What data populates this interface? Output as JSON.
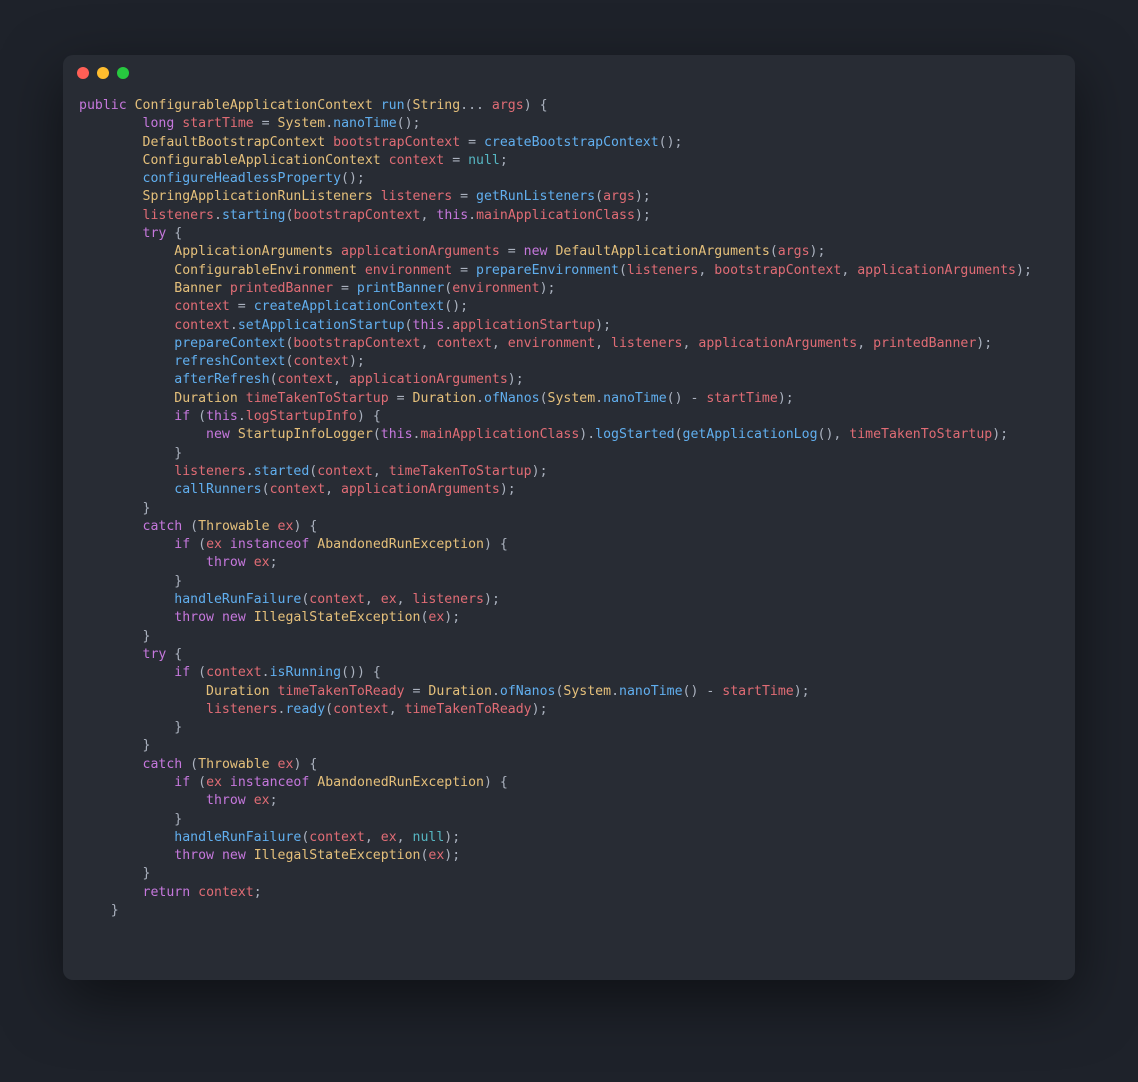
{
  "window": {
    "traffic_lights": [
      "close",
      "minimize",
      "maximize"
    ]
  },
  "code": {
    "tokens": [
      [
        [
          "k",
          "public"
        ],
        [
          "s",
          " "
        ],
        [
          "t",
          "ConfigurableApplicationContext"
        ],
        [
          "s",
          " "
        ],
        [
          "m",
          "run"
        ],
        [
          "s",
          "("
        ],
        [
          "t",
          "String"
        ],
        [
          "s",
          "... "
        ],
        [
          "v",
          "args"
        ],
        [
          "s",
          ") {"
        ]
      ],
      [
        [
          "s",
          "        "
        ],
        [
          "k",
          "long"
        ],
        [
          "s",
          " "
        ],
        [
          "v",
          "startTime"
        ],
        [
          "s",
          " = "
        ],
        [
          "t",
          "System"
        ],
        [
          "s",
          "."
        ],
        [
          "m",
          "nanoTime"
        ],
        [
          "s",
          "();"
        ]
      ],
      [
        [
          "s",
          "        "
        ],
        [
          "t",
          "DefaultBootstrapContext"
        ],
        [
          "s",
          " "
        ],
        [
          "v",
          "bootstrapContext"
        ],
        [
          "s",
          " = "
        ],
        [
          "m",
          "createBootstrapContext"
        ],
        [
          "s",
          "();"
        ]
      ],
      [
        [
          "s",
          "        "
        ],
        [
          "t",
          "ConfigurableApplicationContext"
        ],
        [
          "s",
          " "
        ],
        [
          "v",
          "context"
        ],
        [
          "s",
          " = "
        ],
        [
          "n",
          "null"
        ],
        [
          "s",
          ";"
        ]
      ],
      [
        [
          "s",
          "        "
        ],
        [
          "m",
          "configureHeadlessProperty"
        ],
        [
          "s",
          "();"
        ]
      ],
      [
        [
          "s",
          "        "
        ],
        [
          "t",
          "SpringApplicationRunListeners"
        ],
        [
          "s",
          " "
        ],
        [
          "v",
          "listeners"
        ],
        [
          "s",
          " = "
        ],
        [
          "m",
          "getRunListeners"
        ],
        [
          "s",
          "("
        ],
        [
          "v",
          "args"
        ],
        [
          "s",
          ");"
        ]
      ],
      [
        [
          "s",
          "        "
        ],
        [
          "v",
          "listeners"
        ],
        [
          "s",
          "."
        ],
        [
          "m",
          "starting"
        ],
        [
          "s",
          "("
        ],
        [
          "v",
          "bootstrapContext"
        ],
        [
          "s",
          ", "
        ],
        [
          "k",
          "this"
        ],
        [
          "s",
          "."
        ],
        [
          "v",
          "mainApplicationClass"
        ],
        [
          "s",
          ");"
        ]
      ],
      [
        [
          "s",
          "        "
        ],
        [
          "k",
          "try"
        ],
        [
          "s",
          " {"
        ]
      ],
      [
        [
          "s",
          "            "
        ],
        [
          "t",
          "ApplicationArguments"
        ],
        [
          "s",
          " "
        ],
        [
          "v",
          "applicationArguments"
        ],
        [
          "s",
          " = "
        ],
        [
          "k",
          "new"
        ],
        [
          "s",
          " "
        ],
        [
          "t",
          "DefaultApplicationArguments"
        ],
        [
          "s",
          "("
        ],
        [
          "v",
          "args"
        ],
        [
          "s",
          ");"
        ]
      ],
      [
        [
          "s",
          "            "
        ],
        [
          "t",
          "ConfigurableEnvironment"
        ],
        [
          "s",
          " "
        ],
        [
          "v",
          "environment"
        ],
        [
          "s",
          " = "
        ],
        [
          "m",
          "prepareEnvironment"
        ],
        [
          "s",
          "("
        ],
        [
          "v",
          "listeners"
        ],
        [
          "s",
          ", "
        ],
        [
          "v",
          "bootstrapContext"
        ],
        [
          "s",
          ", "
        ],
        [
          "v",
          "applicationArguments"
        ],
        [
          "s",
          ");"
        ]
      ],
      [
        [
          "s",
          "            "
        ],
        [
          "t",
          "Banner"
        ],
        [
          "s",
          " "
        ],
        [
          "v",
          "printedBanner"
        ],
        [
          "s",
          " = "
        ],
        [
          "m",
          "printBanner"
        ],
        [
          "s",
          "("
        ],
        [
          "v",
          "environment"
        ],
        [
          "s",
          ");"
        ]
      ],
      [
        [
          "s",
          "            "
        ],
        [
          "v",
          "context"
        ],
        [
          "s",
          " = "
        ],
        [
          "m",
          "createApplicationContext"
        ],
        [
          "s",
          "();"
        ]
      ],
      [
        [
          "s",
          "            "
        ],
        [
          "v",
          "context"
        ],
        [
          "s",
          "."
        ],
        [
          "m",
          "setApplicationStartup"
        ],
        [
          "s",
          "("
        ],
        [
          "k",
          "this"
        ],
        [
          "s",
          "."
        ],
        [
          "v",
          "applicationStartup"
        ],
        [
          "s",
          ");"
        ]
      ],
      [
        [
          "s",
          "            "
        ],
        [
          "m",
          "prepareContext"
        ],
        [
          "s",
          "("
        ],
        [
          "v",
          "bootstrapContext"
        ],
        [
          "s",
          ", "
        ],
        [
          "v",
          "context"
        ],
        [
          "s",
          ", "
        ],
        [
          "v",
          "environment"
        ],
        [
          "s",
          ", "
        ],
        [
          "v",
          "listeners"
        ],
        [
          "s",
          ", "
        ],
        [
          "v",
          "applicationArguments"
        ],
        [
          "s",
          ", "
        ],
        [
          "v",
          "printedBanner"
        ],
        [
          "s",
          ");"
        ]
      ],
      [
        [
          "s",
          "            "
        ],
        [
          "m",
          "refreshContext"
        ],
        [
          "s",
          "("
        ],
        [
          "v",
          "context"
        ],
        [
          "s",
          ");"
        ]
      ],
      [
        [
          "s",
          "            "
        ],
        [
          "m",
          "afterRefresh"
        ],
        [
          "s",
          "("
        ],
        [
          "v",
          "context"
        ],
        [
          "s",
          ", "
        ],
        [
          "v",
          "applicationArguments"
        ],
        [
          "s",
          ");"
        ]
      ],
      [
        [
          "s",
          "            "
        ],
        [
          "t",
          "Duration"
        ],
        [
          "s",
          " "
        ],
        [
          "v",
          "timeTakenToStartup"
        ],
        [
          "s",
          " = "
        ],
        [
          "t",
          "Duration"
        ],
        [
          "s",
          "."
        ],
        [
          "m",
          "ofNanos"
        ],
        [
          "s",
          "("
        ],
        [
          "t",
          "System"
        ],
        [
          "s",
          "."
        ],
        [
          "m",
          "nanoTime"
        ],
        [
          "s",
          "() - "
        ],
        [
          "v",
          "startTime"
        ],
        [
          "s",
          ");"
        ]
      ],
      [
        [
          "s",
          "            "
        ],
        [
          "k",
          "if"
        ],
        [
          "s",
          " ("
        ],
        [
          "k",
          "this"
        ],
        [
          "s",
          "."
        ],
        [
          "v",
          "logStartupInfo"
        ],
        [
          "s",
          ") {"
        ]
      ],
      [
        [
          "s",
          "                "
        ],
        [
          "k",
          "new"
        ],
        [
          "s",
          " "
        ],
        [
          "t",
          "StartupInfoLogger"
        ],
        [
          "s",
          "("
        ],
        [
          "k",
          "this"
        ],
        [
          "s",
          "."
        ],
        [
          "v",
          "mainApplicationClass"
        ],
        [
          "s",
          ")."
        ],
        [
          "m",
          "logStarted"
        ],
        [
          "s",
          "("
        ],
        [
          "m",
          "getApplicationLog"
        ],
        [
          "s",
          "(), "
        ],
        [
          "v",
          "timeTakenToStartup"
        ],
        [
          "s",
          ");"
        ]
      ],
      [
        [
          "s",
          "            }"
        ]
      ],
      [
        [
          "s",
          "            "
        ],
        [
          "v",
          "listeners"
        ],
        [
          "s",
          "."
        ],
        [
          "m",
          "started"
        ],
        [
          "s",
          "("
        ],
        [
          "v",
          "context"
        ],
        [
          "s",
          ", "
        ],
        [
          "v",
          "timeTakenToStartup"
        ],
        [
          "s",
          ");"
        ]
      ],
      [
        [
          "s",
          "            "
        ],
        [
          "m",
          "callRunners"
        ],
        [
          "s",
          "("
        ],
        [
          "v",
          "context"
        ],
        [
          "s",
          ", "
        ],
        [
          "v",
          "applicationArguments"
        ],
        [
          "s",
          ");"
        ]
      ],
      [
        [
          "s",
          "        }"
        ]
      ],
      [
        [
          "s",
          "        "
        ],
        [
          "k",
          "catch"
        ],
        [
          "s",
          " ("
        ],
        [
          "t",
          "Throwable"
        ],
        [
          "s",
          " "
        ],
        [
          "v",
          "ex"
        ],
        [
          "s",
          ") {"
        ]
      ],
      [
        [
          "s",
          "            "
        ],
        [
          "k",
          "if"
        ],
        [
          "s",
          " ("
        ],
        [
          "v",
          "ex"
        ],
        [
          "s",
          " "
        ],
        [
          "k",
          "instanceof"
        ],
        [
          "s",
          " "
        ],
        [
          "t",
          "AbandonedRunException"
        ],
        [
          "s",
          ") {"
        ]
      ],
      [
        [
          "s",
          "                "
        ],
        [
          "k",
          "throw"
        ],
        [
          "s",
          " "
        ],
        [
          "v",
          "ex"
        ],
        [
          "s",
          ";"
        ]
      ],
      [
        [
          "s",
          "            }"
        ]
      ],
      [
        [
          "s",
          "            "
        ],
        [
          "m",
          "handleRunFailure"
        ],
        [
          "s",
          "("
        ],
        [
          "v",
          "context"
        ],
        [
          "s",
          ", "
        ],
        [
          "v",
          "ex"
        ],
        [
          "s",
          ", "
        ],
        [
          "v",
          "listeners"
        ],
        [
          "s",
          ");"
        ]
      ],
      [
        [
          "s",
          "            "
        ],
        [
          "k",
          "throw"
        ],
        [
          "s",
          " "
        ],
        [
          "k",
          "new"
        ],
        [
          "s",
          " "
        ],
        [
          "t",
          "IllegalStateException"
        ],
        [
          "s",
          "("
        ],
        [
          "v",
          "ex"
        ],
        [
          "s",
          ");"
        ]
      ],
      [
        [
          "s",
          "        }"
        ]
      ],
      [
        [
          "s",
          "        "
        ],
        [
          "k",
          "try"
        ],
        [
          "s",
          " {"
        ]
      ],
      [
        [
          "s",
          "            "
        ],
        [
          "k",
          "if"
        ],
        [
          "s",
          " ("
        ],
        [
          "v",
          "context"
        ],
        [
          "s",
          "."
        ],
        [
          "m",
          "isRunning"
        ],
        [
          "s",
          "()) {"
        ]
      ],
      [
        [
          "s",
          "                "
        ],
        [
          "t",
          "Duration"
        ],
        [
          "s",
          " "
        ],
        [
          "v",
          "timeTakenToReady"
        ],
        [
          "s",
          " = "
        ],
        [
          "t",
          "Duration"
        ],
        [
          "s",
          "."
        ],
        [
          "m",
          "ofNanos"
        ],
        [
          "s",
          "("
        ],
        [
          "t",
          "System"
        ],
        [
          "s",
          "."
        ],
        [
          "m",
          "nanoTime"
        ],
        [
          "s",
          "() - "
        ],
        [
          "v",
          "startTime"
        ],
        [
          "s",
          ");"
        ]
      ],
      [
        [
          "s",
          "                "
        ],
        [
          "v",
          "listeners"
        ],
        [
          "s",
          "."
        ],
        [
          "m",
          "ready"
        ],
        [
          "s",
          "("
        ],
        [
          "v",
          "context"
        ],
        [
          "s",
          ", "
        ],
        [
          "v",
          "timeTakenToReady"
        ],
        [
          "s",
          ");"
        ]
      ],
      [
        [
          "s",
          "            }"
        ]
      ],
      [
        [
          "s",
          "        }"
        ]
      ],
      [
        [
          "s",
          "        "
        ],
        [
          "k",
          "catch"
        ],
        [
          "s",
          " ("
        ],
        [
          "t",
          "Throwable"
        ],
        [
          "s",
          " "
        ],
        [
          "v",
          "ex"
        ],
        [
          "s",
          ") {"
        ]
      ],
      [
        [
          "s",
          "            "
        ],
        [
          "k",
          "if"
        ],
        [
          "s",
          " ("
        ],
        [
          "v",
          "ex"
        ],
        [
          "s",
          " "
        ],
        [
          "k",
          "instanceof"
        ],
        [
          "s",
          " "
        ],
        [
          "t",
          "AbandonedRunException"
        ],
        [
          "s",
          ") {"
        ]
      ],
      [
        [
          "s",
          "                "
        ],
        [
          "k",
          "throw"
        ],
        [
          "s",
          " "
        ],
        [
          "v",
          "ex"
        ],
        [
          "s",
          ";"
        ]
      ],
      [
        [
          "s",
          "            }"
        ]
      ],
      [
        [
          "s",
          "            "
        ],
        [
          "m",
          "handleRunFailure"
        ],
        [
          "s",
          "("
        ],
        [
          "v",
          "context"
        ],
        [
          "s",
          ", "
        ],
        [
          "v",
          "ex"
        ],
        [
          "s",
          ", "
        ],
        [
          "n",
          "null"
        ],
        [
          "s",
          ");"
        ]
      ],
      [
        [
          "s",
          "            "
        ],
        [
          "k",
          "throw"
        ],
        [
          "s",
          " "
        ],
        [
          "k",
          "new"
        ],
        [
          "s",
          " "
        ],
        [
          "t",
          "IllegalStateException"
        ],
        [
          "s",
          "("
        ],
        [
          "v",
          "ex"
        ],
        [
          "s",
          ");"
        ]
      ],
      [
        [
          "s",
          "        }"
        ]
      ],
      [
        [
          "s",
          "        "
        ],
        [
          "k",
          "return"
        ],
        [
          "s",
          " "
        ],
        [
          "v",
          "context"
        ],
        [
          "s",
          ";"
        ]
      ],
      [
        [
          "s",
          "    }"
        ]
      ]
    ]
  }
}
